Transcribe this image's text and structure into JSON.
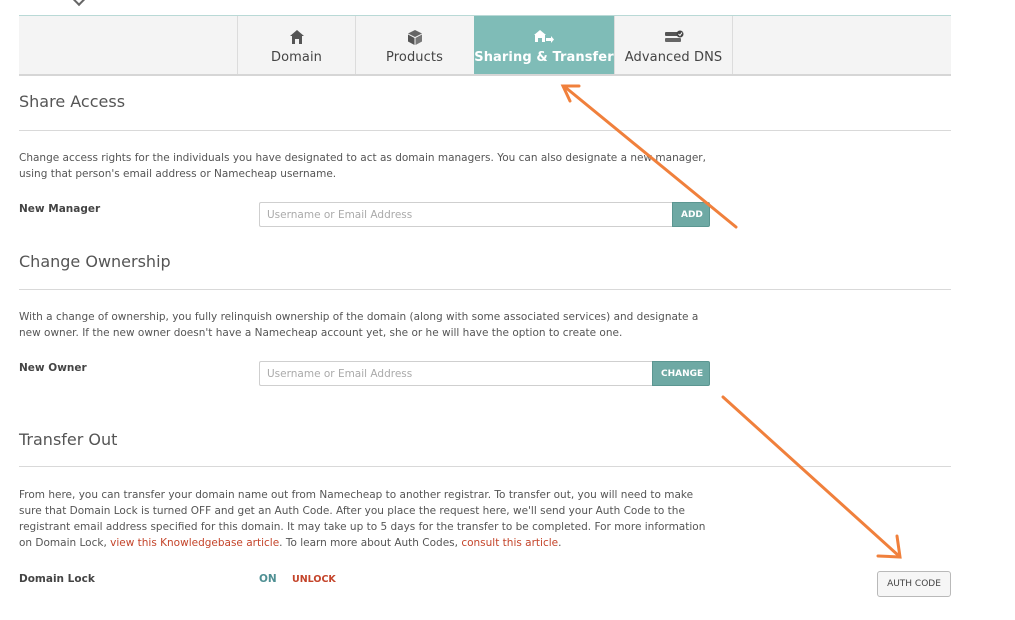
{
  "tabs": [
    {
      "label": "Domain",
      "icon": "home-icon",
      "active": false
    },
    {
      "label": "Products",
      "icon": "box-icon",
      "active": false
    },
    {
      "label": "Sharing & Transfer",
      "icon": "share-transfer-icon",
      "active": true
    },
    {
      "label": "Advanced DNS",
      "icon": "server-icon",
      "active": false
    }
  ],
  "share": {
    "title": "Share Access",
    "description": "Change access rights for the individuals you have designated to act as domain managers. You can also designate a new manager, using that person's email address or Namecheap username.",
    "field_label": "New Manager",
    "placeholder": "Username or Email Address",
    "button": "ADD"
  },
  "ownership": {
    "title": "Change Ownership",
    "description": "With a change of ownership, you fully relinquish ownership of the domain (along with some associated services) and designate a new owner. If the new owner doesn't have a Namecheap account yet, she or he will have the option to create one.",
    "field_label": "New Owner",
    "placeholder": "Username or Email Address",
    "button": "CHANGE"
  },
  "transfer": {
    "title": "Transfer Out",
    "description_1": "From here, you can transfer your domain name out from Namecheap to another registrar. To transfer out, you will need to make sure that Domain Lock is turned OFF and get an Auth Code. After you place the request here, we'll send your Auth Code to the registrant email address specified for this domain. It may take up to 5 days for the transfer to be completed. For more information on Domain Lock, ",
    "link_1": "view this Knowledgebase article",
    "description_2": ". To learn more about Auth Codes, ",
    "link_2": "consult this article",
    "description_3": ".",
    "lock_label": "Domain Lock",
    "lock_state": "ON",
    "unlock_link": "UNLOCK",
    "auth_button": "AUTH CODE"
  },
  "colors": {
    "accent": "#7fbcb7",
    "link": "#c4442a",
    "annotation": "#f0803c"
  }
}
